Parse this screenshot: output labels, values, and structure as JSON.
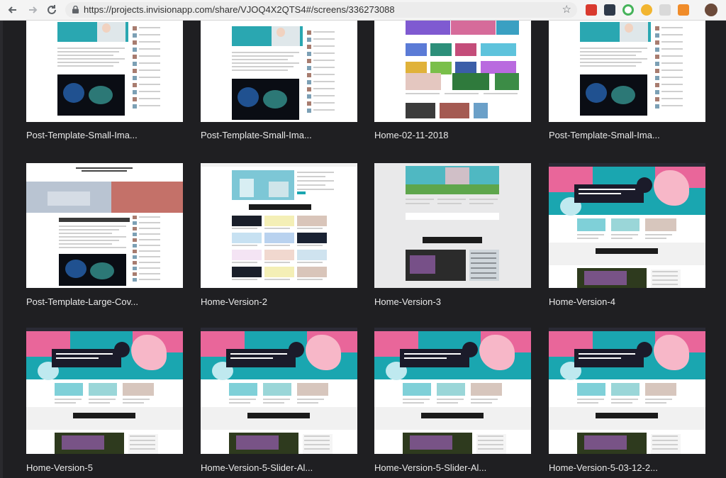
{
  "browser": {
    "url": "https://projects.invisionapp.com/share/VJOQ4X2QTS4#/screens/336273088",
    "back_icon": "arrow-left-icon",
    "forward_icon": "arrow-right-icon",
    "reload_icon": "reload-icon",
    "lock_icon": "lock-icon",
    "bookmark_icon": "star-icon",
    "extensions": [
      "red-ext-icon",
      "layers-ext-icon",
      "green-circle-ext-icon",
      "yellow-ext-icon",
      "gray-ext-icon",
      "orange-chart-ext-icon",
      "avatar-icon"
    ]
  },
  "screens": [
    {
      "title": "Post-Template-Small-Ima...",
      "variant": "post"
    },
    {
      "title": "Post-Template-Small-Ima...",
      "variant": "post2"
    },
    {
      "title": "Home-02-11-2018",
      "variant": "homegrid"
    },
    {
      "title": "Post-Template-Small-Ima...",
      "variant": "post"
    },
    {
      "title": "Post-Template-Large-Cov...",
      "variant": "postlarge"
    },
    {
      "title": "Home-Version-2",
      "variant": "home2"
    },
    {
      "title": "Home-Version-3",
      "variant": "home3"
    },
    {
      "title": "Home-Version-4",
      "variant": "home4"
    },
    {
      "title": "Home-Version-5",
      "variant": "home4"
    },
    {
      "title": "Home-Version-5-Slider-Al...",
      "variant": "home4"
    },
    {
      "title": "Home-Version-5-Slider-Al...",
      "variant": "home4"
    },
    {
      "title": "Home-Version-5-03-12-2...",
      "variant": "home4"
    }
  ],
  "colors": {
    "background": "#1f1f22",
    "teal": "#1aa6b0",
    "pink": "#e9669a",
    "dark": "#1b1b2a"
  }
}
